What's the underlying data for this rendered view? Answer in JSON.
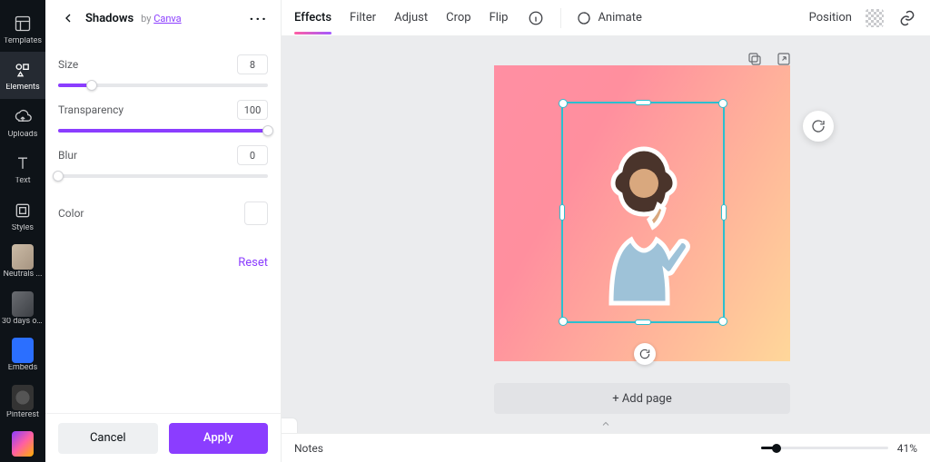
{
  "left_nav": {
    "items": [
      {
        "key": "templates",
        "label": "Templates"
      },
      {
        "key": "elements",
        "label": "Elements"
      },
      {
        "key": "uploads",
        "label": "Uploads"
      },
      {
        "key": "text",
        "label": "Text"
      },
      {
        "key": "styles",
        "label": "Styles"
      },
      {
        "key": "neutrals",
        "label": "Neutrals ..."
      },
      {
        "key": "30days",
        "label": "30 days of..."
      },
      {
        "key": "embeds",
        "label": "Embeds"
      },
      {
        "key": "pinterest",
        "label": "Pinterest"
      }
    ],
    "active_key": "elements"
  },
  "panel": {
    "title": "Shadows",
    "by_prefix": "by ",
    "by_link_text": "Canva",
    "sliders": {
      "size": {
        "label": "Size",
        "value": 8,
        "min": 0,
        "max": 50
      },
      "transparency": {
        "label": "Transparency",
        "value": 100,
        "min": 0,
        "max": 100
      },
      "blur": {
        "label": "Blur",
        "value": 0,
        "min": 0,
        "max": 100
      }
    },
    "color_label": "Color",
    "color_value": "#ffffff",
    "reset_label": "Reset",
    "cancel_label": "Cancel",
    "apply_label": "Apply"
  },
  "toolbar": {
    "tabs": [
      {
        "key": "effects",
        "label": "Effects"
      },
      {
        "key": "filter",
        "label": "Filter"
      },
      {
        "key": "adjust",
        "label": "Adjust"
      },
      {
        "key": "crop",
        "label": "Crop"
      },
      {
        "key": "flip",
        "label": "Flip"
      }
    ],
    "active_tab": "effects",
    "animate_label": "Animate",
    "position_label": "Position"
  },
  "canvas": {
    "add_page_label": "+ Add page",
    "selected_element": "photo-person"
  },
  "bottom": {
    "notes_label": "Notes",
    "zoom_percent": 41,
    "zoom_display": "41%"
  },
  "colors": {
    "accent": "#8b3dff",
    "selection": "#2bbfcf"
  }
}
